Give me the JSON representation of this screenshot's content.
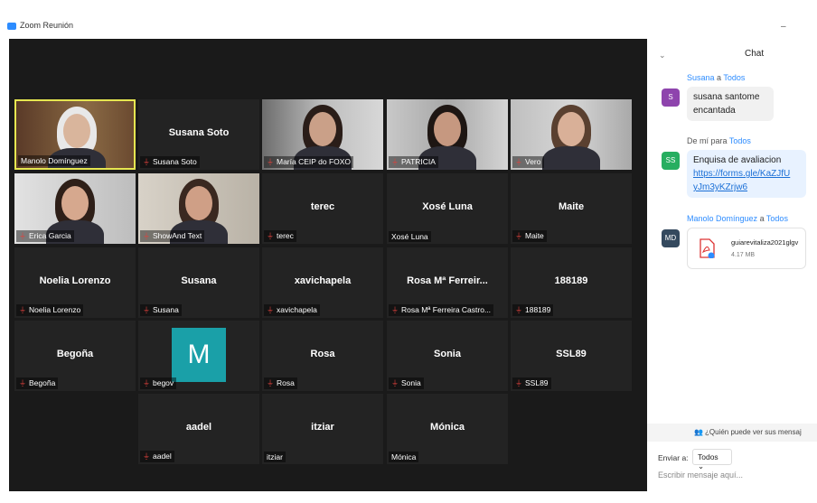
{
  "window": {
    "title": "Zoom Reunión",
    "minimize": "–"
  },
  "participants": [
    {
      "name": "Manolo Domínguez",
      "label": "Manolo Domínguez",
      "type": "video",
      "muted": false,
      "active": true
    },
    {
      "name": "Susana Soto",
      "label": "Susana Soto",
      "type": "name",
      "muted": true
    },
    {
      "name": "María CEIP do FOXO",
      "label": "María CEIP do FOXO",
      "type": "video",
      "muted": true
    },
    {
      "name": "PATRICIA",
      "label": "PATRICIA",
      "type": "video",
      "muted": true
    },
    {
      "name": "Vero",
      "label": "Vero",
      "type": "video",
      "muted": true
    },
    {
      "name": "Erica Garcia",
      "label": "Erica Garcia",
      "type": "video",
      "muted": true
    },
    {
      "name": "ShowAnd Text",
      "label": "ShowAnd Text",
      "type": "video",
      "muted": true
    },
    {
      "name": "terec",
      "label": "terec",
      "type": "name",
      "muted": true
    },
    {
      "name": "Xosé Luna",
      "label": "Xosé Luna",
      "type": "name",
      "muted": false
    },
    {
      "name": "Maite",
      "label": "Maite",
      "type": "name",
      "muted": true
    },
    {
      "name": "Noelia Lorenzo",
      "label": "Noelia Lorenzo",
      "type": "name",
      "muted": true
    },
    {
      "name": "Susana",
      "label": "Susana",
      "type": "name",
      "muted": true
    },
    {
      "name": "xavichapela",
      "label": "xavichapela",
      "type": "name",
      "muted": true
    },
    {
      "name": "Rosa Mª Ferreir...",
      "label": "Rosa Mª Ferreira Castro...",
      "type": "name",
      "muted": true
    },
    {
      "name": "188189",
      "label": "188189",
      "type": "name",
      "muted": true
    },
    {
      "name": "Begoña",
      "label": "Begoña",
      "type": "name",
      "muted": true
    },
    {
      "name": "M",
      "label": "begov",
      "type": "avatar",
      "muted": true
    },
    {
      "name": "Rosa",
      "label": "Rosa",
      "type": "name",
      "muted": true
    },
    {
      "name": "Sonia",
      "label": "Sonia",
      "type": "name",
      "muted": true
    },
    {
      "name": "SSL89",
      "label": "SSL89",
      "type": "name",
      "muted": true
    },
    {
      "name": "aadel",
      "label": "aadel",
      "type": "name",
      "muted": true
    },
    {
      "name": "itziar",
      "label": "itziar",
      "type": "name",
      "muted": false
    },
    {
      "name": "Mónica",
      "label": "Mónica",
      "type": "name",
      "muted": false
    }
  ],
  "chat": {
    "title": "Chat",
    "messages": [
      {
        "sender": "Susana",
        "to_word": "a",
        "recipient": "Todos",
        "initials": "S",
        "badge_color": "#8e44ad",
        "text": "susana santome encantada"
      },
      {
        "sender": "De mí",
        "to_word": "para",
        "recipient": "Todos",
        "initials": "SS",
        "badge_color": "#27ae60",
        "text": "Enquisa de avaliacion",
        "link": "https://forms.gle/KaZJfUyJm3yKZrjw6",
        "link_line1": "https://forms.gle/KaZJfU",
        "link_line2": "yJm3yKZrjw6"
      },
      {
        "sender": "Manolo Domínguez",
        "to_word": "a",
        "recipient": "Todos",
        "initials": "MD",
        "badge_color": "#34495e",
        "file_name": "guiarevitaliza2021glgv",
        "file_size": "4.17 MB"
      }
    ],
    "who_can_see": "¿Quién puede ver sus mensaj",
    "send_to_label": "Enviar a:",
    "send_to_value": "Todos ⌄",
    "compose_placeholder": "Escribir mensaje aquí..."
  },
  "icons": {
    "mic_muted": "mic-muted-icon",
    "pdf": "pdf-icon",
    "people": "people-icon",
    "chevron": "chevron-down-icon"
  }
}
